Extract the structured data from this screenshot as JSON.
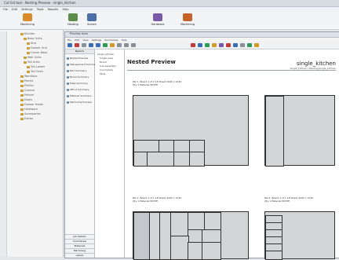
{
  "app": {
    "title": "Cut list tool - Nesting Preview - single_kitchen",
    "menu": [
      "File",
      "Edit",
      "Settings",
      "Tools",
      "Reports",
      "Help"
    ]
  },
  "ribbon": [
    {
      "label": "Machining",
      "icon": "machining-icon",
      "color": "#d78b2c"
    },
    {
      "label": "Nesting",
      "icon": "nesting-icon",
      "color": "#5a8d4a"
    },
    {
      "label": "Screen",
      "icon": "screen-icon",
      "color": "#4c6fa8"
    },
    {
      "label": "Hardware",
      "icon": "hardware-icon",
      "color": "#7a5aa8"
    },
    {
      "label": "Machining",
      "icon": "machining2-icon",
      "color": "#c4622a"
    }
  ],
  "tree": {
    "items": [
      "Kitchen",
      "Base Units",
      "Sink",
      "Drawer Unit",
      "Corner Base",
      "Wall Units",
      "Tall Units",
      "Tall Larder",
      "Tall Oven",
      "Worktops",
      "Panels",
      "Plinths",
      "Cornice",
      "Pelmet",
      "Doors",
      "Drawer fronts",
      "Hardware",
      "Accessories",
      "Extras"
    ]
  },
  "window": {
    "title": "Preview Area",
    "menu": [
      "File",
      "Edit",
      "View",
      "Settings",
      "Summaries",
      "Help"
    ]
  },
  "reports": {
    "header": "Reports",
    "items": [
      "Nested Preview",
      "Management Summary",
      "Part Summary",
      "Board Summary",
      "Edge Summary",
      "Offcut Summary",
      "Material Summary",
      "Machining Preview"
    ],
    "buttons": [
      "Job Details",
      "Summaries",
      "Materials",
      "Machining",
      "Labels"
    ]
  },
  "job_tree": {
    "items": [
      "single_kitchen",
      "Single pass",
      "Board",
      "Sub-assembly",
      "Incomplete",
      "Parts"
    ]
  },
  "preview": {
    "title": "Nested Preview",
    "project": "single_kitchen",
    "subtitle": "single_kitchen / Nesting/single_kitchen",
    "boards": [
      {
        "caption": "Pat 1  Board 1 of 2 18 Sheet 2440 x 1220\nQty 1 Material WHITE"
      },
      {
        "caption": "Pat 2  Board 1 of 1 18 Sheet 2440 x 1220\nQty 1 Material WHITE"
      },
      {
        "caption": "Pat 3  Board 1 of 1 18 Sheet 2440 x 1220\nQty 1 Material WHITE"
      },
      {
        "caption": "Pat 4  Board 1 of 1 18 Sheet 2440 x 1220\nQty 1 Material WHITE"
      }
    ]
  }
}
